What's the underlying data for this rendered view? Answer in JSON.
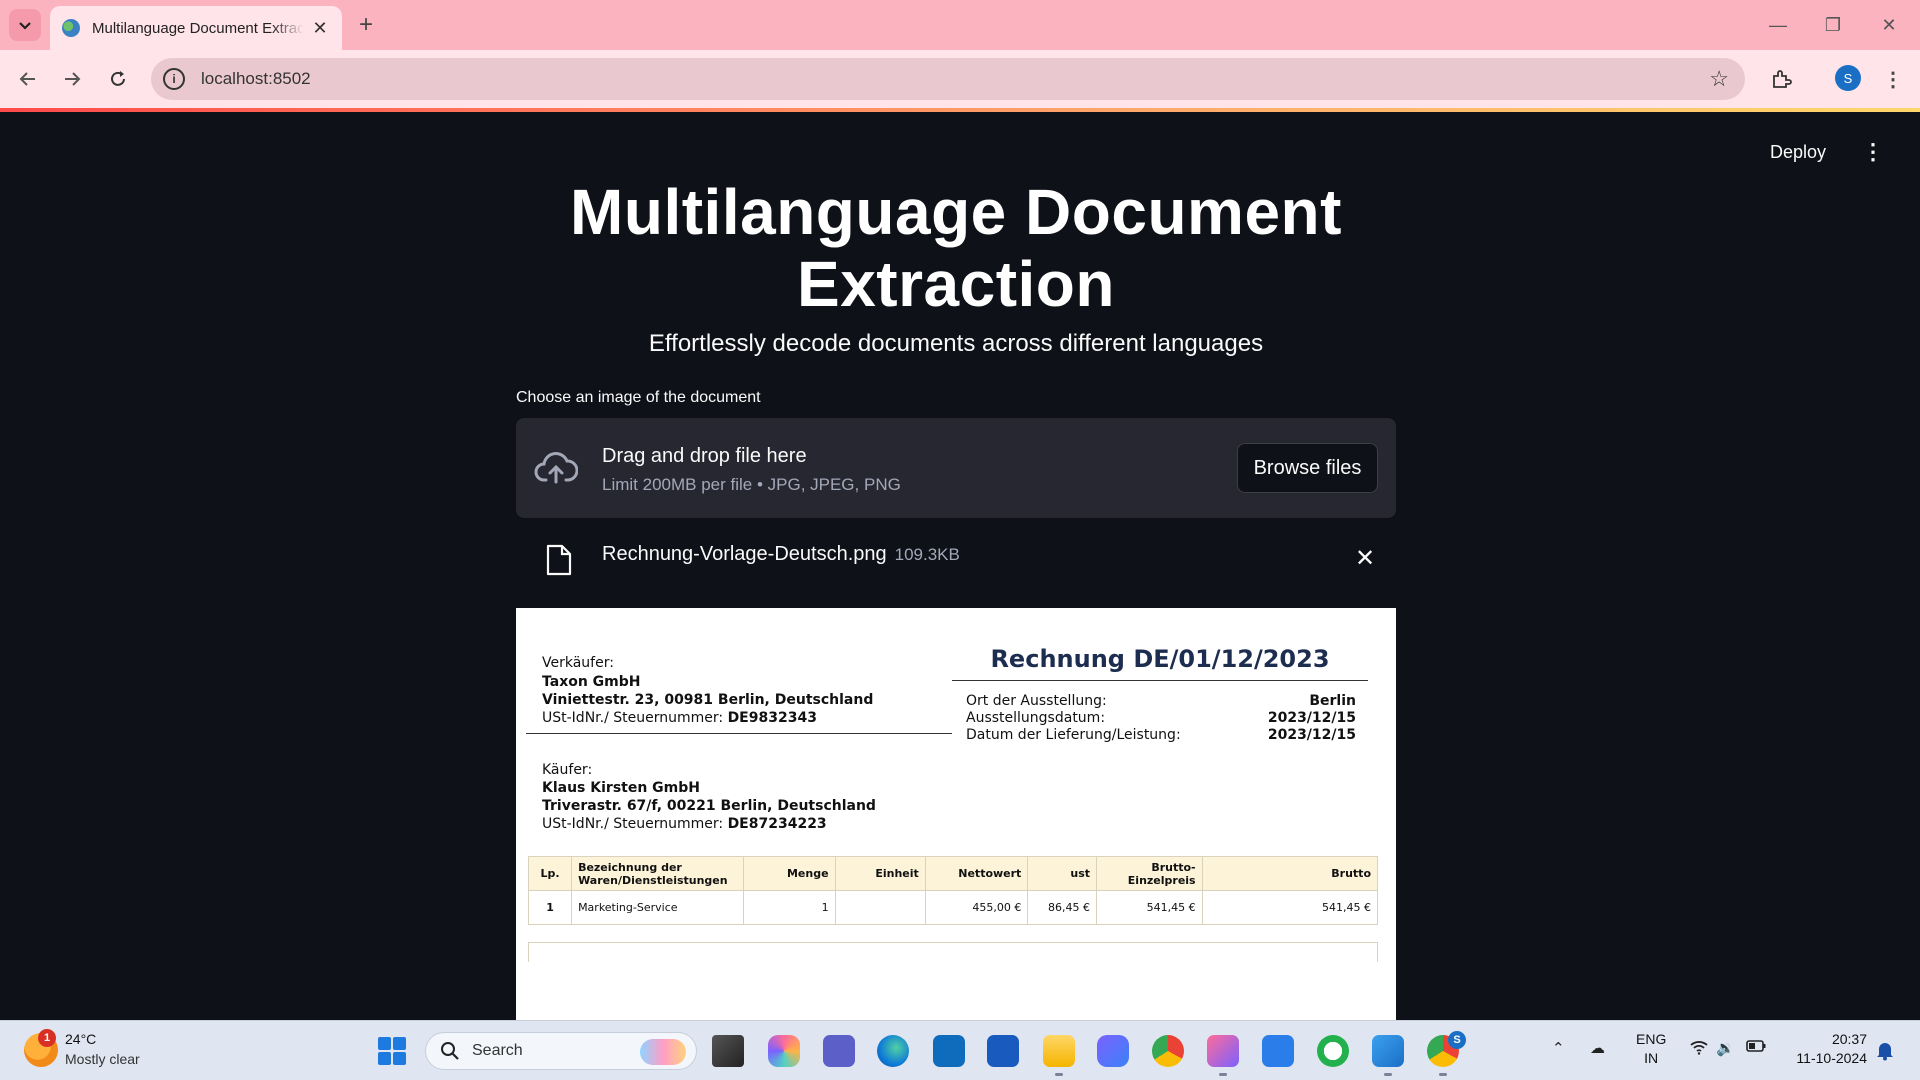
{
  "browser": {
    "tab_title": "Multilanguage Document Extraction",
    "url": "localhost:8502",
    "profile_initial": "S"
  },
  "app": {
    "deploy_label": "Deploy",
    "title": "Multilanguage Document Extraction",
    "subtitle": "Effortlessly decode documents across different languages",
    "uploader": {
      "label": "Choose an image of the document",
      "drop_title": "Drag and drop file here",
      "limit": "Limit 200MB per file • JPG, JPEG, PNG",
      "browse_label": "Browse files"
    },
    "file": {
      "name": "Rechnung-Vorlage-Deutsch.png",
      "size": "109.3KB"
    }
  },
  "invoice": {
    "title": "Rechnung DE/01/12/2023",
    "seller_label": "Verkäufer:",
    "seller_name": "Taxon GmbH",
    "seller_address": "Viniettestr. 23, 00981 Berlin, Deutschland",
    "seller_tax_label": "USt-IdNr./ Steuernummer:",
    "seller_tax": "DE9832343",
    "place_label": "Ort der Ausstellung:",
    "place": "Berlin",
    "issue_label": "Ausstellungsdatum:",
    "issue_date": "2023/12/15",
    "delivery_label": "Datum der Lieferung/Leistung:",
    "delivery_date": "2023/12/15",
    "buyer_label": "Käufer:",
    "buyer_name": "Klaus Kirsten GmbH",
    "buyer_address": "Triverastr. 67/f, 00221 Berlin, Deutschland",
    "buyer_tax_label": "USt-IdNr./ Steuernummer:",
    "buyer_tax": "DE87234223",
    "columns": [
      "Lp.",
      "Bezeichnung der Waren/Dienstleistungen",
      "Menge",
      "Einheit",
      "Nettowert",
      "ust",
      "Brutto-Einzelpreis",
      "Brutto"
    ],
    "rows": [
      [
        "1",
        "Marketing-Service",
        "1",
        "",
        "455,00 €",
        "86,45 €",
        "541,45 €",
        "541,45 €"
      ]
    ]
  },
  "taskbar": {
    "weather_badge": "1",
    "temperature": "24°C",
    "weather": "Mostly clear",
    "search_placeholder": "Search",
    "lang_top": "ENG",
    "lang_bottom": "IN",
    "time": "20:37",
    "date": "11-10-2024",
    "chat_badge": "S"
  },
  "colors": {
    "tabbar": "#fcb3c0",
    "app_bg": "#0e1117",
    "dropzone_bg": "#262730",
    "accent": "#ff4b4b"
  }
}
